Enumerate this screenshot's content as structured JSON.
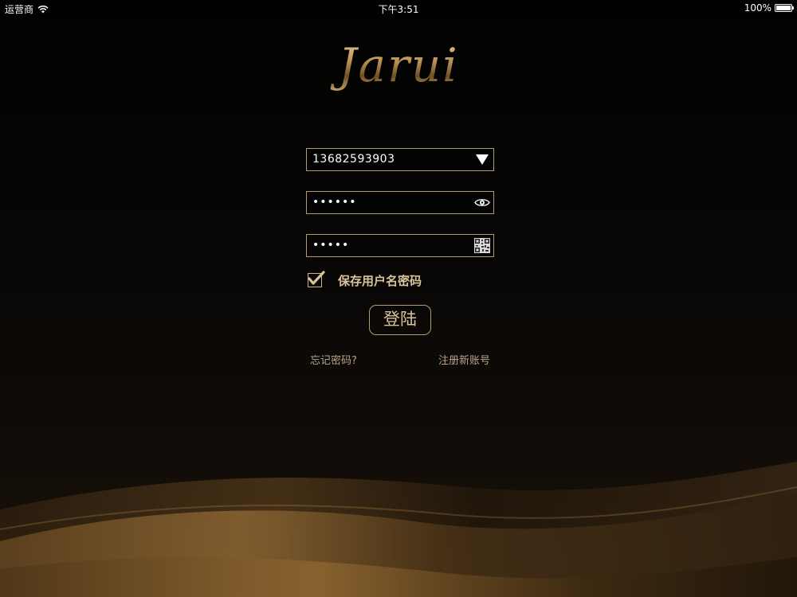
{
  "status_bar": {
    "carrier": "运营商",
    "time": "下午3:51",
    "battery": "100%",
    "battery_level": 1.0
  },
  "logo": {
    "text": "Jarui"
  },
  "form": {
    "username_value": "13682593903",
    "password_value": "••••••",
    "captcha_value": "•••••",
    "remember_label": "保存用户名密码",
    "remember_checked": true,
    "login_label": "登陆",
    "forgot_label": "忘记密码?",
    "register_label": "注册新账号"
  },
  "icons": {
    "username_dropdown": "triangle-down-icon",
    "password_toggle": "eye-icon",
    "captcha": "qr-code-icon",
    "wifi": "wifi-icon",
    "battery": "battery-icon",
    "checkbox": "checkmark-icon"
  },
  "colors": {
    "accent_gold": "#b49a6f",
    "label_gold": "#d9c39a",
    "background": "#050403"
  }
}
